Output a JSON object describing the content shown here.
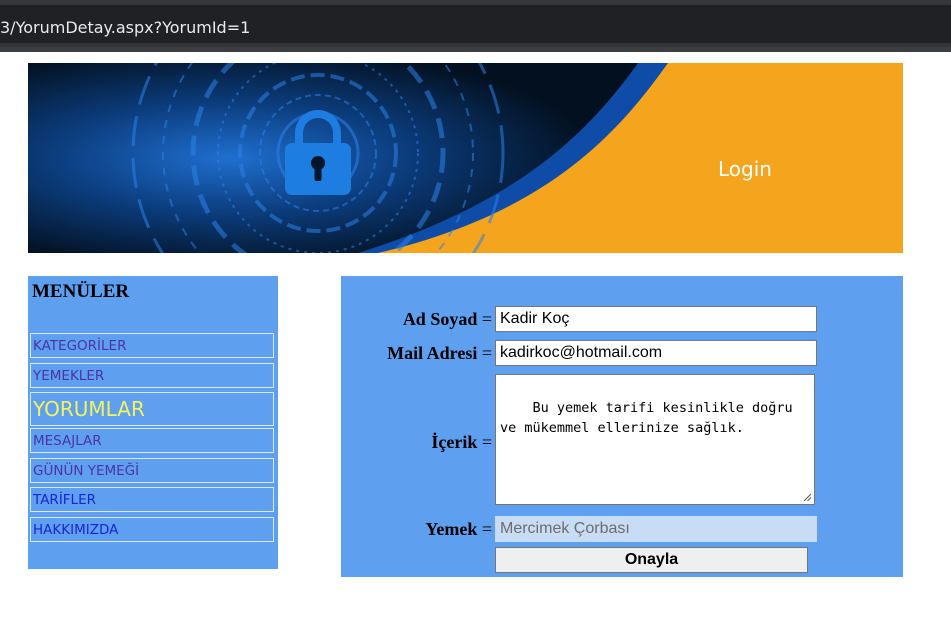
{
  "browser": {
    "url": "3/YorumDetay.aspx?YorumId=1"
  },
  "banner": {
    "login_text": "Login",
    "colors": {
      "dark": "#061a33",
      "blue": "#0e4ca8",
      "orange": "#f5a51d"
    }
  },
  "sidebar": {
    "title": "MENÜLER",
    "items": [
      {
        "label": "KATEGORİLER"
      },
      {
        "label": "YEMEKLER"
      },
      {
        "label": "YORUMLAR"
      },
      {
        "label": "MESAJLAR"
      },
      {
        "label": "GÜNÜN YEMEĞİ"
      },
      {
        "label": "TARİFLER"
      },
      {
        "label": "HAKKIMIZDA"
      }
    ]
  },
  "form": {
    "ad_soyad": {
      "label": "Ad Soyad",
      "value": "Kadir Koç"
    },
    "mail": {
      "label": "Mail Adresi",
      "value": "kadirkoc@hotmail.com"
    },
    "icerik": {
      "label": "İçerik",
      "value": "Bu yemek tarifi kesinlikle doğru\nve mükemmel ellerinize sağlık."
    },
    "yemek": {
      "label": "Yemek",
      "value": "Mercimek Çorbası"
    },
    "equals": "=",
    "submit_label": "Onayla"
  }
}
